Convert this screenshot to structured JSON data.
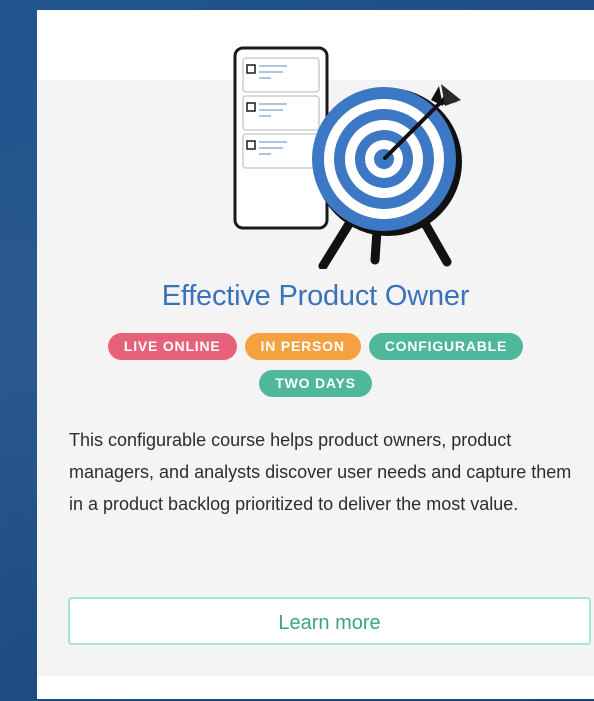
{
  "card": {
    "title": "Effective Product Owner",
    "tags": [
      {
        "label": "LIVE ONLINE",
        "color": "#e5627a"
      },
      {
        "label": "IN PERSON",
        "color": "#f3a23f"
      },
      {
        "label": "CONFIGURABLE",
        "color": "#4fb89a"
      },
      {
        "label": "TWO DAYS",
        "color": "#4fb89a"
      }
    ],
    "description": "This configurable course helps product owners, product managers, and analysts discover user needs and capture them in a product backlog prioritized to deliver the most value.",
    "cta_label": "Learn more",
    "illustration_icons": [
      "backlog-phone-icon",
      "target-icon",
      "arrow-icon"
    ]
  },
  "colors": {
    "background": "#1f4f86",
    "title": "#3b73b8",
    "cta_text": "#3aa585",
    "cta_border": "#a7e4d3"
  }
}
